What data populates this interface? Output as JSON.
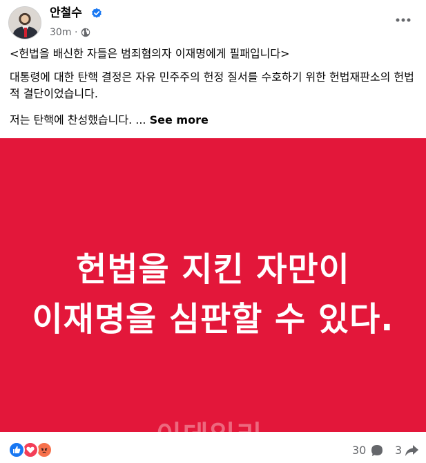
{
  "post": {
    "author": "안철수",
    "time": "30m",
    "separator": "·",
    "text_line1": "<헌법을 배신한 자들은 범죄혐의자 이재명에게 필패입니다>",
    "text_line2": "대통령에 대한 탄핵 결정은 자유 민주주의 헌정 질서를 수호하기 위한 헌법재판소의 헌법적 결단이었습니다.",
    "text_line4": "저는 탄핵에 찬성했습니다. ... ",
    "see_more": "See more"
  },
  "image": {
    "background_color": "#e3173a",
    "line1": "헌법을 지킨 자만이",
    "line2": "이재명을 심판할 수 있다.",
    "watermark": "이데일리"
  },
  "footer": {
    "reactions": [
      "like-icon",
      "love-icon",
      "angry-icon"
    ],
    "comment_count": "30",
    "share_count": "3"
  },
  "icons": {
    "verified": "verified-badge-icon",
    "privacy": "globe-icon",
    "more": "more-options-icon",
    "comment": "comment-icon",
    "share": "share-icon"
  },
  "colors": {
    "verified": "#1877f2",
    "like": "#1877f2",
    "love": "#f33e58",
    "angry": "#f7714c"
  }
}
